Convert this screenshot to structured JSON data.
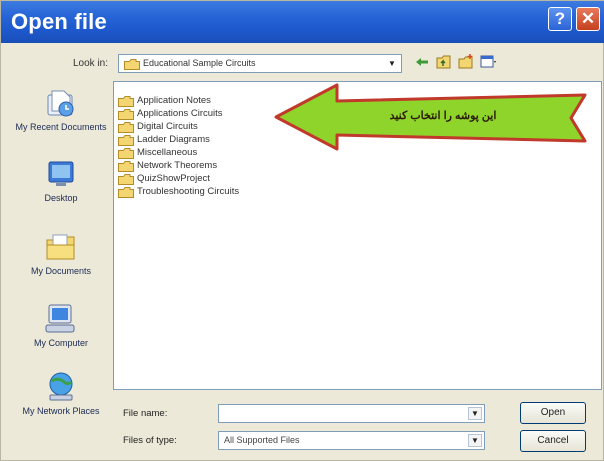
{
  "window": {
    "title": "Open file"
  },
  "lookin": {
    "label": "Look in:",
    "value": "Educational Sample Circuits"
  },
  "places": [
    {
      "label": "My Recent Documents"
    },
    {
      "label": "Desktop"
    },
    {
      "label": "My Documents"
    },
    {
      "label": "My Computer"
    },
    {
      "label": "My Network Places"
    }
  ],
  "files": [
    {
      "name": "Application Notes"
    },
    {
      "name": "Applications Circuits"
    },
    {
      "name": "Digital Circuits"
    },
    {
      "name": "Ladder Diagrams"
    },
    {
      "name": "Miscellaneous"
    },
    {
      "name": "Network Theorems"
    },
    {
      "name": "QuizShowProject"
    },
    {
      "name": "Troubleshooting Circuits"
    }
  ],
  "callout": {
    "text": "این پوشه را انتخاب کنید"
  },
  "filename": {
    "label": "File name:",
    "value": ""
  },
  "filetype": {
    "label": "Files of type:",
    "value": "All Supported Files"
  },
  "buttons": {
    "open": "Open",
    "cancel": "Cancel"
  },
  "colors": {
    "titlebar": "#2563d6",
    "callout_fill": "#8fd42a",
    "callout_border": "#c0392b"
  }
}
